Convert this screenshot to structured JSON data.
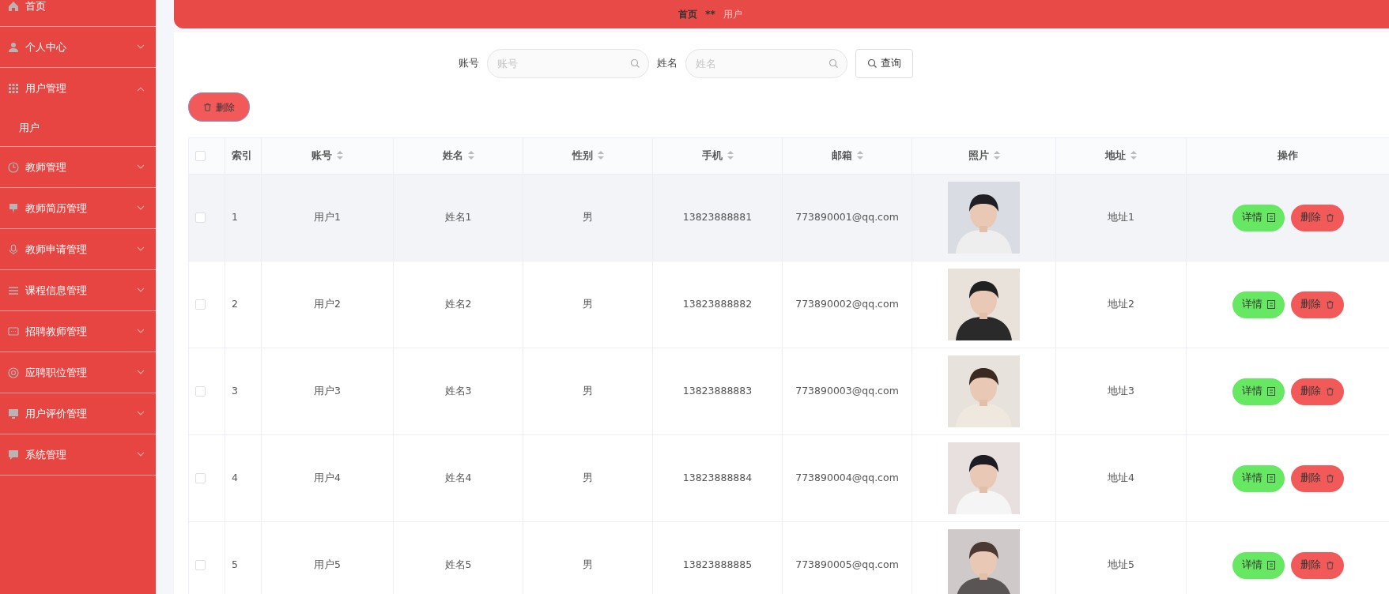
{
  "sidebar": {
    "items": [
      {
        "kind": "link",
        "label": "首页"
      },
      {
        "kind": "menu",
        "label": "个人中心",
        "expanded": false
      },
      {
        "kind": "menu",
        "label": "用户管理",
        "expanded": true,
        "children": [
          {
            "label": "用户"
          }
        ]
      },
      {
        "kind": "menu",
        "label": "教师管理",
        "expanded": false
      },
      {
        "kind": "menu",
        "label": "教师简历管理",
        "expanded": false
      },
      {
        "kind": "menu",
        "label": "教师申请管理",
        "expanded": false
      },
      {
        "kind": "menu",
        "label": "课程信息管理",
        "expanded": false
      },
      {
        "kind": "menu",
        "label": "招聘教师管理",
        "expanded": false
      },
      {
        "kind": "menu",
        "label": "应聘职位管理",
        "expanded": false
      },
      {
        "kind": "menu",
        "label": "用户评价管理",
        "expanded": false
      },
      {
        "kind": "menu",
        "label": "系统管理",
        "expanded": false
      }
    ]
  },
  "breadcrumb": {
    "items": [
      "首页",
      "用户"
    ],
    "separator": "**"
  },
  "search": {
    "fields": [
      {
        "label": "账号",
        "placeholder": "账号"
      },
      {
        "label": "姓名",
        "placeholder": "姓名"
      }
    ],
    "button": "查询"
  },
  "toolbar": {
    "delete_button": "删除"
  },
  "table": {
    "header_checkbox": {
      "checked": false
    },
    "columns": [
      {
        "label": "索引",
        "sortable": false
      },
      {
        "label": "账号",
        "sortable": true
      },
      {
        "label": "姓名",
        "sortable": true
      },
      {
        "label": "性别",
        "sortable": true
      },
      {
        "label": "手机",
        "sortable": true
      },
      {
        "label": "邮箱",
        "sortable": true
      },
      {
        "label": "照片",
        "sortable": true
      },
      {
        "label": "地址",
        "sortable": true
      },
      {
        "label": "操作",
        "sortable": false
      }
    ],
    "rows": [
      {
        "checked": false,
        "highlighted": true,
        "index": "1",
        "account": "用户1",
        "name": "姓名1",
        "gender": "男",
        "phone": "13823888881",
        "email": "773890001@qq.com",
        "address": "地址1",
        "detail": "详情",
        "delete": "删除"
      },
      {
        "checked": false,
        "highlighted": false,
        "index": "2",
        "account": "用户2",
        "name": "姓名2",
        "gender": "男",
        "phone": "13823888882",
        "email": "773890002@qq.com",
        "address": "地址2",
        "detail": "详情",
        "delete": "删除"
      },
      {
        "checked": false,
        "highlighted": false,
        "index": "3",
        "account": "用户3",
        "name": "姓名3",
        "gender": "男",
        "phone": "13823888883",
        "email": "773890003@qq.com",
        "address": "地址3",
        "detail": "详情",
        "delete": "删除"
      },
      {
        "checked": false,
        "highlighted": false,
        "index": "4",
        "account": "用户4",
        "name": "姓名4",
        "gender": "男",
        "phone": "13823888884",
        "email": "773890004@qq.com",
        "address": "地址4",
        "detail": "详情",
        "delete": "删除"
      },
      {
        "checked": false,
        "highlighted": false,
        "index": "5",
        "account": "用户5",
        "name": "姓名5",
        "gender": "男",
        "phone": "13823888885",
        "email": "773890005@qq.com",
        "address": "地址5",
        "detail": "详情",
        "delete": "删除"
      }
    ]
  }
}
